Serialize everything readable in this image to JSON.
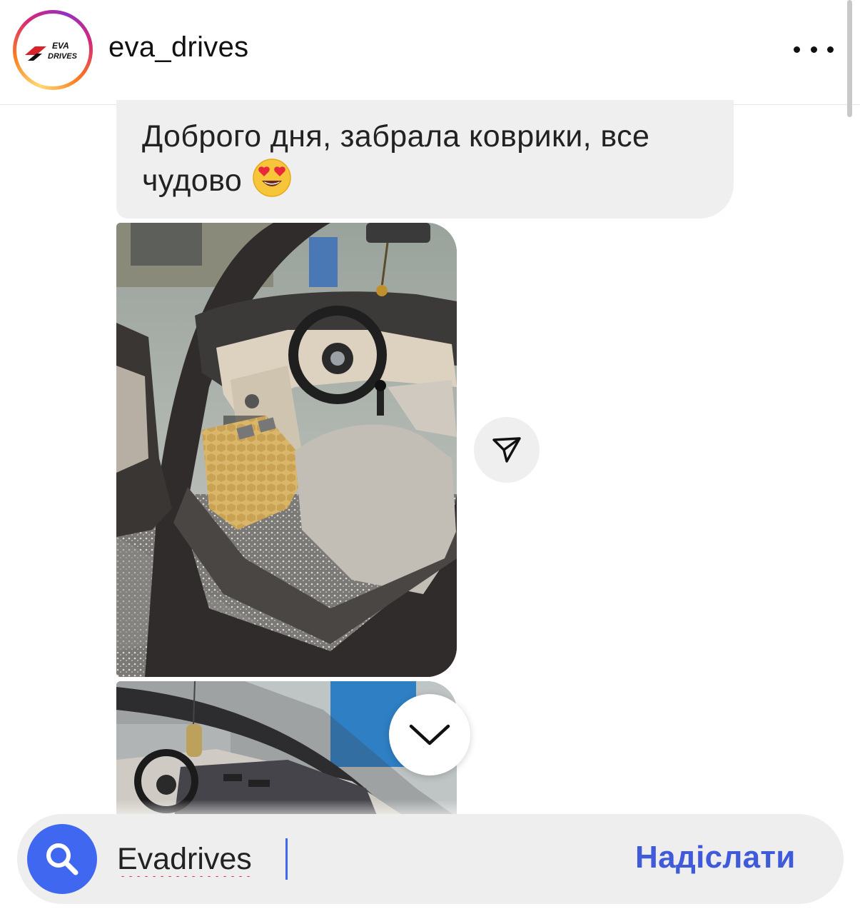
{
  "header": {
    "username": "eva_drives",
    "avatar_logo_text_line1": "EVA",
    "avatar_logo_text_line2": "DRIVES",
    "more_icon": "more-horizontal-icon"
  },
  "message": {
    "text": "Доброго дня, забрала коврики, все чудово",
    "emoji": "heart-eyes-emoji"
  },
  "photos": [
    {
      "description_icon": "car-interior-photo"
    },
    {
      "description_icon": "car-interior-photo"
    }
  ],
  "actions": {
    "share_icon": "share-send-icon",
    "scroll_down_icon": "chevron-down-icon"
  },
  "composer": {
    "search_icon": "search-icon",
    "input_value": "Evadrives",
    "send_label": "Надіслати"
  },
  "colors": {
    "accent": "#3f67f0",
    "send_text": "#3f5bd9",
    "bubble": "#efefef"
  }
}
